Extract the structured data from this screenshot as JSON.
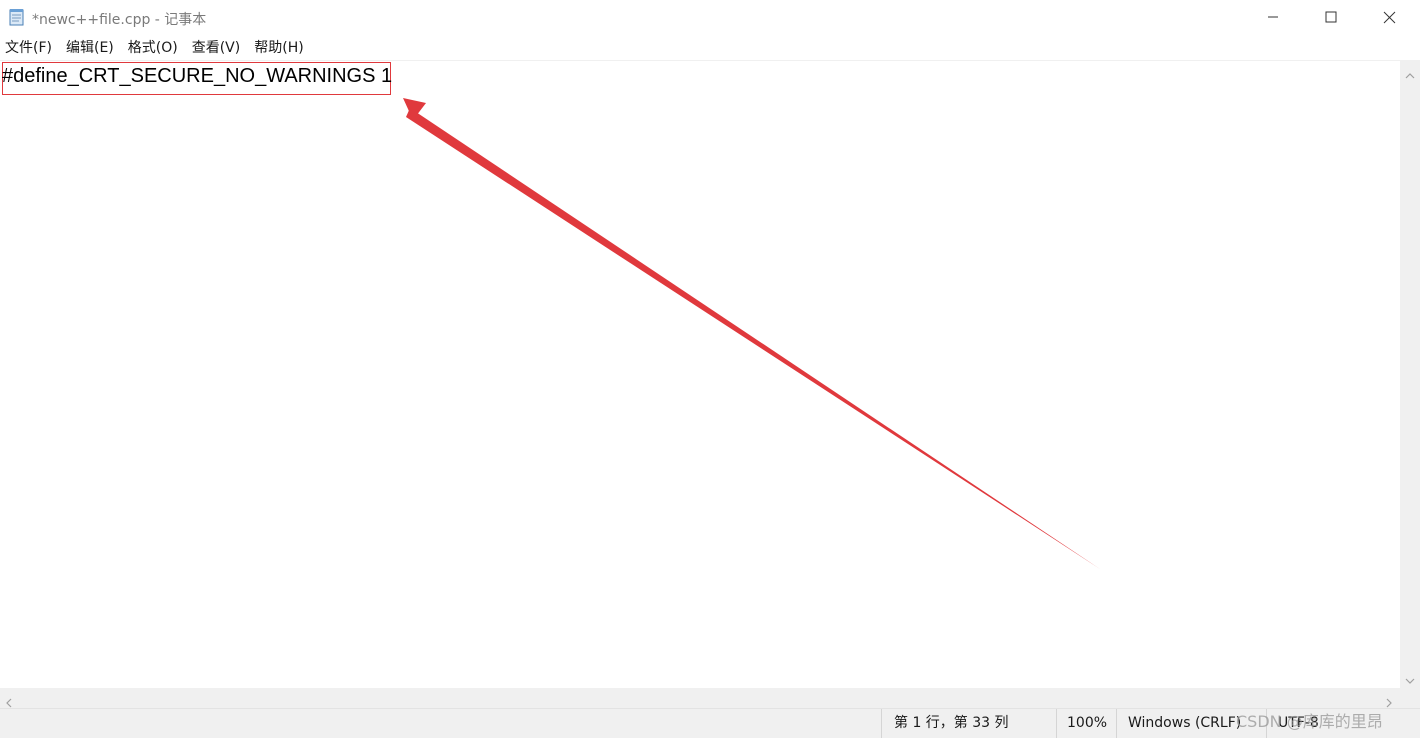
{
  "window": {
    "title": "*newc++file.cpp - 记事本",
    "app_icon": "notepad-icon",
    "controls": [
      "minimize-icon",
      "maximize-icon",
      "close-icon"
    ]
  },
  "menu": {
    "items": [
      {
        "label": "文件(F)"
      },
      {
        "label": "编辑(E)"
      },
      {
        "label": "格式(O)"
      },
      {
        "label": "查看(V)"
      },
      {
        "label": "帮助(H)"
      }
    ]
  },
  "editor": {
    "content": "#define_CRT_SECURE_NO_WARNINGS 1"
  },
  "annotation": {
    "color": "#e0393d"
  },
  "status": {
    "position": "第 1 行，第 33 列",
    "zoom": "100%",
    "line_ending": "Windows (CRLF)",
    "encoding": "UTF-8"
  },
  "watermark": "CSDN @库库的里昂"
}
